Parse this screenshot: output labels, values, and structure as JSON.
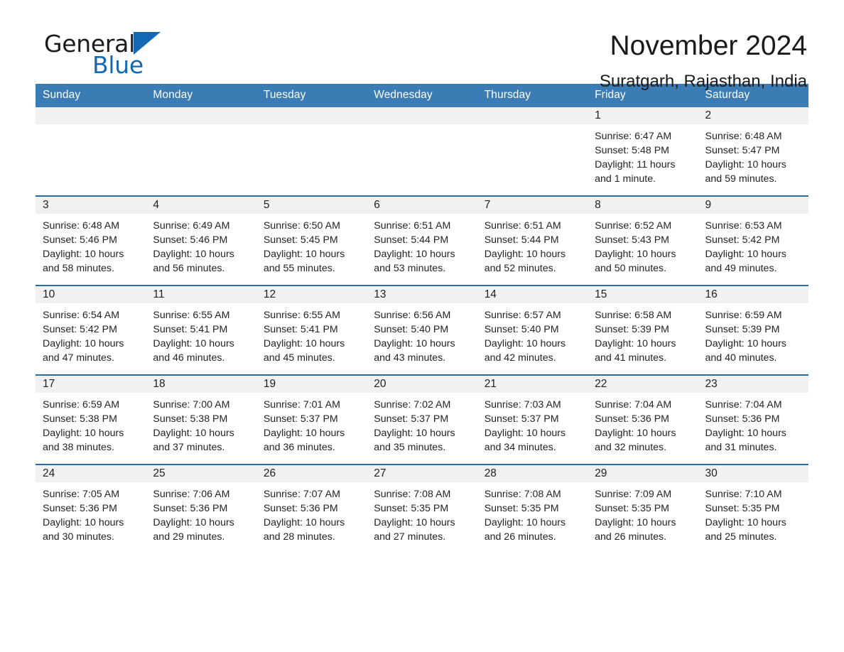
{
  "brand": {
    "name_part1": "General",
    "name_part2": "Blue",
    "accent_color": "#1268b3"
  },
  "header": {
    "title": "November 2024",
    "location": "Suratgarh, Rajasthan, India"
  },
  "calendar": {
    "header_bg": "#3b7cb5",
    "row_border_color": "#2b6ca8",
    "daynum_band_bg": "#f1f1f1",
    "weekday_headers": [
      "Sunday",
      "Monday",
      "Tuesday",
      "Wednesday",
      "Thursday",
      "Friday",
      "Saturday"
    ],
    "weeks": [
      [
        {
          "day": "",
          "lines": []
        },
        {
          "day": "",
          "lines": []
        },
        {
          "day": "",
          "lines": []
        },
        {
          "day": "",
          "lines": []
        },
        {
          "day": "",
          "lines": []
        },
        {
          "day": "1",
          "lines": [
            "Sunrise: 6:47 AM",
            "Sunset: 5:48 PM",
            "Daylight: 11 hours",
            "and 1 minute."
          ]
        },
        {
          "day": "2",
          "lines": [
            "Sunrise: 6:48 AM",
            "Sunset: 5:47 PM",
            "Daylight: 10 hours",
            "and 59 minutes."
          ]
        }
      ],
      [
        {
          "day": "3",
          "lines": [
            "Sunrise: 6:48 AM",
            "Sunset: 5:46 PM",
            "Daylight: 10 hours",
            "and 58 minutes."
          ]
        },
        {
          "day": "4",
          "lines": [
            "Sunrise: 6:49 AM",
            "Sunset: 5:46 PM",
            "Daylight: 10 hours",
            "and 56 minutes."
          ]
        },
        {
          "day": "5",
          "lines": [
            "Sunrise: 6:50 AM",
            "Sunset: 5:45 PM",
            "Daylight: 10 hours",
            "and 55 minutes."
          ]
        },
        {
          "day": "6",
          "lines": [
            "Sunrise: 6:51 AM",
            "Sunset: 5:44 PM",
            "Daylight: 10 hours",
            "and 53 minutes."
          ]
        },
        {
          "day": "7",
          "lines": [
            "Sunrise: 6:51 AM",
            "Sunset: 5:44 PM",
            "Daylight: 10 hours",
            "and 52 minutes."
          ]
        },
        {
          "day": "8",
          "lines": [
            "Sunrise: 6:52 AM",
            "Sunset: 5:43 PM",
            "Daylight: 10 hours",
            "and 50 minutes."
          ]
        },
        {
          "day": "9",
          "lines": [
            "Sunrise: 6:53 AM",
            "Sunset: 5:42 PM",
            "Daylight: 10 hours",
            "and 49 minutes."
          ]
        }
      ],
      [
        {
          "day": "10",
          "lines": [
            "Sunrise: 6:54 AM",
            "Sunset: 5:42 PM",
            "Daylight: 10 hours",
            "and 47 minutes."
          ]
        },
        {
          "day": "11",
          "lines": [
            "Sunrise: 6:55 AM",
            "Sunset: 5:41 PM",
            "Daylight: 10 hours",
            "and 46 minutes."
          ]
        },
        {
          "day": "12",
          "lines": [
            "Sunrise: 6:55 AM",
            "Sunset: 5:41 PM",
            "Daylight: 10 hours",
            "and 45 minutes."
          ]
        },
        {
          "day": "13",
          "lines": [
            "Sunrise: 6:56 AM",
            "Sunset: 5:40 PM",
            "Daylight: 10 hours",
            "and 43 minutes."
          ]
        },
        {
          "day": "14",
          "lines": [
            "Sunrise: 6:57 AM",
            "Sunset: 5:40 PM",
            "Daylight: 10 hours",
            "and 42 minutes."
          ]
        },
        {
          "day": "15",
          "lines": [
            "Sunrise: 6:58 AM",
            "Sunset: 5:39 PM",
            "Daylight: 10 hours",
            "and 41 minutes."
          ]
        },
        {
          "day": "16",
          "lines": [
            "Sunrise: 6:59 AM",
            "Sunset: 5:39 PM",
            "Daylight: 10 hours",
            "and 40 minutes."
          ]
        }
      ],
      [
        {
          "day": "17",
          "lines": [
            "Sunrise: 6:59 AM",
            "Sunset: 5:38 PM",
            "Daylight: 10 hours",
            "and 38 minutes."
          ]
        },
        {
          "day": "18",
          "lines": [
            "Sunrise: 7:00 AM",
            "Sunset: 5:38 PM",
            "Daylight: 10 hours",
            "and 37 minutes."
          ]
        },
        {
          "day": "19",
          "lines": [
            "Sunrise: 7:01 AM",
            "Sunset: 5:37 PM",
            "Daylight: 10 hours",
            "and 36 minutes."
          ]
        },
        {
          "day": "20",
          "lines": [
            "Sunrise: 7:02 AM",
            "Sunset: 5:37 PM",
            "Daylight: 10 hours",
            "and 35 minutes."
          ]
        },
        {
          "day": "21",
          "lines": [
            "Sunrise: 7:03 AM",
            "Sunset: 5:37 PM",
            "Daylight: 10 hours",
            "and 34 minutes."
          ]
        },
        {
          "day": "22",
          "lines": [
            "Sunrise: 7:04 AM",
            "Sunset: 5:36 PM",
            "Daylight: 10 hours",
            "and 32 minutes."
          ]
        },
        {
          "day": "23",
          "lines": [
            "Sunrise: 7:04 AM",
            "Sunset: 5:36 PM",
            "Daylight: 10 hours",
            "and 31 minutes."
          ]
        }
      ],
      [
        {
          "day": "24",
          "lines": [
            "Sunrise: 7:05 AM",
            "Sunset: 5:36 PM",
            "Daylight: 10 hours",
            "and 30 minutes."
          ]
        },
        {
          "day": "25",
          "lines": [
            "Sunrise: 7:06 AM",
            "Sunset: 5:36 PM",
            "Daylight: 10 hours",
            "and 29 minutes."
          ]
        },
        {
          "day": "26",
          "lines": [
            "Sunrise: 7:07 AM",
            "Sunset: 5:36 PM",
            "Daylight: 10 hours",
            "and 28 minutes."
          ]
        },
        {
          "day": "27",
          "lines": [
            "Sunrise: 7:08 AM",
            "Sunset: 5:35 PM",
            "Daylight: 10 hours",
            "and 27 minutes."
          ]
        },
        {
          "day": "28",
          "lines": [
            "Sunrise: 7:08 AM",
            "Sunset: 5:35 PM",
            "Daylight: 10 hours",
            "and 26 minutes."
          ]
        },
        {
          "day": "29",
          "lines": [
            "Sunrise: 7:09 AM",
            "Sunset: 5:35 PM",
            "Daylight: 10 hours",
            "and 26 minutes."
          ]
        },
        {
          "day": "30",
          "lines": [
            "Sunrise: 7:10 AM",
            "Sunset: 5:35 PM",
            "Daylight: 10 hours",
            "and 25 minutes."
          ]
        }
      ]
    ]
  }
}
